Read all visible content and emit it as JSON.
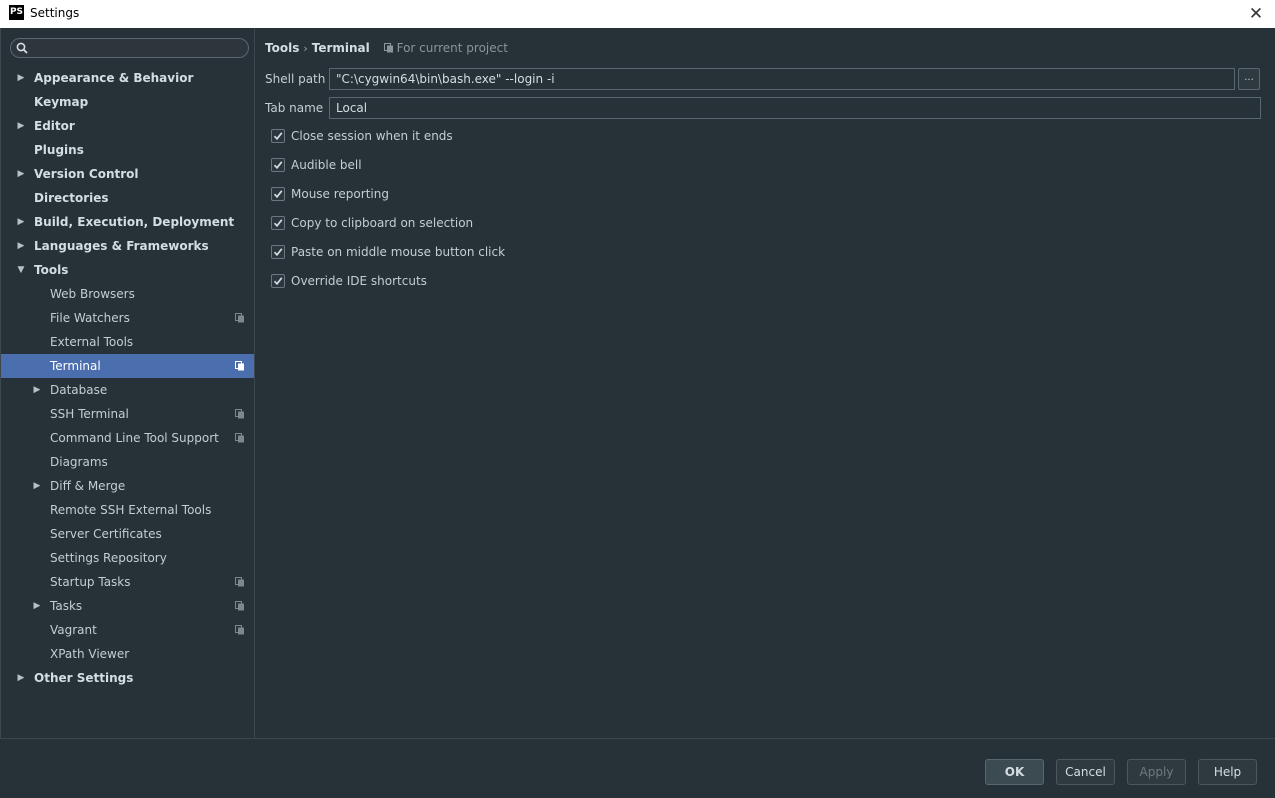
{
  "window": {
    "title": "Settings",
    "logo": "PS"
  },
  "sidebar": {
    "search_placeholder": "",
    "items": [
      {
        "label": "Appearance & Behavior",
        "level": 0,
        "arrow": "right",
        "project": false
      },
      {
        "label": "Keymap",
        "level": 0,
        "arrow": "none",
        "project": false
      },
      {
        "label": "Editor",
        "level": 0,
        "arrow": "right",
        "project": false
      },
      {
        "label": "Plugins",
        "level": 0,
        "arrow": "none",
        "project": false
      },
      {
        "label": "Version Control",
        "level": 0,
        "arrow": "right",
        "project": false
      },
      {
        "label": "Directories",
        "level": 0,
        "arrow": "none",
        "project": false
      },
      {
        "label": "Build, Execution, Deployment",
        "level": 0,
        "arrow": "right",
        "project": false
      },
      {
        "label": "Languages & Frameworks",
        "level": 0,
        "arrow": "right",
        "project": false
      },
      {
        "label": "Tools",
        "level": 0,
        "arrow": "down",
        "project": false
      },
      {
        "label": "Web Browsers",
        "level": 1,
        "arrow": "none",
        "project": false
      },
      {
        "label": "File Watchers",
        "level": 1,
        "arrow": "none",
        "project": true
      },
      {
        "label": "External Tools",
        "level": 1,
        "arrow": "none",
        "project": false
      },
      {
        "label": "Terminal",
        "level": 1,
        "arrow": "none",
        "project": true,
        "selected": true
      },
      {
        "label": "Database",
        "level": 1,
        "arrow": "right",
        "project": false
      },
      {
        "label": "SSH Terminal",
        "level": 1,
        "arrow": "none",
        "project": true
      },
      {
        "label": "Command Line Tool Support",
        "level": 1,
        "arrow": "none",
        "project": true
      },
      {
        "label": "Diagrams",
        "level": 1,
        "arrow": "none",
        "project": false
      },
      {
        "label": "Diff & Merge",
        "level": 1,
        "arrow": "right",
        "project": false
      },
      {
        "label": "Remote SSH External Tools",
        "level": 1,
        "arrow": "none",
        "project": false
      },
      {
        "label": "Server Certificates",
        "level": 1,
        "arrow": "none",
        "project": false
      },
      {
        "label": "Settings Repository",
        "level": 1,
        "arrow": "none",
        "project": false
      },
      {
        "label": "Startup Tasks",
        "level": 1,
        "arrow": "none",
        "project": true
      },
      {
        "label": "Tasks",
        "level": 1,
        "arrow": "right",
        "project": true
      },
      {
        "label": "Vagrant",
        "level": 1,
        "arrow": "none",
        "project": true
      },
      {
        "label": "XPath Viewer",
        "level": 1,
        "arrow": "none",
        "project": false
      },
      {
        "label": "Other Settings",
        "level": 0,
        "arrow": "right",
        "project": false
      }
    ]
  },
  "main": {
    "breadcrumb": {
      "parent": "Tools",
      "separator": "›",
      "current": "Terminal",
      "scope": "For current project"
    },
    "shell_path": {
      "label": "Shell path",
      "value": "\"C:\\cygwin64\\bin\\bash.exe\" --login -i",
      "browse_label": "..."
    },
    "tab_name": {
      "label": "Tab name",
      "value": "Local"
    },
    "options": [
      {
        "label": "Close session when it ends",
        "checked": true
      },
      {
        "label": "Audible bell",
        "checked": true
      },
      {
        "label": "Mouse reporting",
        "checked": true
      },
      {
        "label": "Copy to clipboard on selection",
        "checked": true
      },
      {
        "label": "Paste on middle mouse button click",
        "checked": true
      },
      {
        "label": "Override IDE shortcuts",
        "checked": true
      }
    ]
  },
  "footer": {
    "ok": "OK",
    "cancel": "Cancel",
    "apply": "Apply",
    "help": "Help"
  },
  "colors": {
    "background": "#263238",
    "selection": "#4b6eaf",
    "text": "#c5cdd3"
  }
}
